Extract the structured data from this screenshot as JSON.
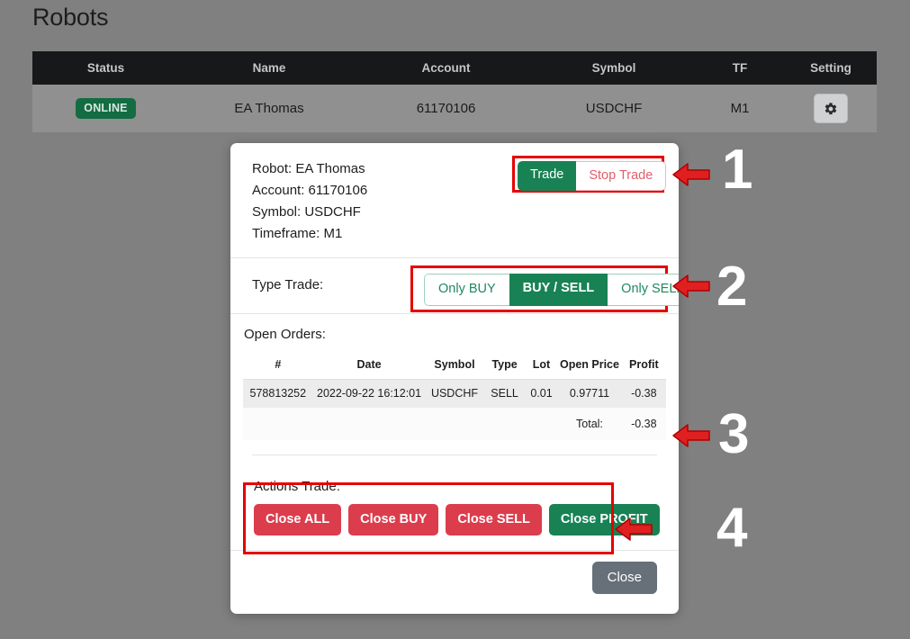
{
  "page": {
    "title": "Robots",
    "background_color": "#808080"
  },
  "robots_table": {
    "columns": [
      "Status",
      "Name",
      "Account",
      "Symbol",
      "TF",
      "Setting"
    ],
    "rows": [
      {
        "status": "ONLINE",
        "name": "EA Thomas",
        "account": "61170106",
        "symbol": "USDCHF",
        "tf": "M1",
        "setting_icon": "gear-icon"
      }
    ],
    "status_color": "#146c43",
    "header_background": "#16181a"
  },
  "modal": {
    "info": {
      "robot": "Robot: EA Thomas",
      "account": "Account: 61170106",
      "symbol": "Symbol: USDCHF",
      "timeframe": "Timeframe: M1"
    },
    "trade_toggle": {
      "active_label": "Trade",
      "inactive_label": "Stop Trade",
      "active_color": "#188254",
      "inactive_text_color": "#e35d6a"
    },
    "type_trade": {
      "label": "Type Trade:",
      "options": [
        "Only BUY",
        "BUY / SELL",
        "Only SELL"
      ],
      "selected": "BUY / SELL",
      "selected_color": "#188254"
    },
    "open_orders": {
      "label": "Open Orders:",
      "columns": [
        "#",
        "Date",
        "Symbol",
        "Type",
        "Lot",
        "Open Price",
        "Profit"
      ],
      "rows": [
        {
          "id": "578813252",
          "date": "2022-09-22 16:12:01",
          "symbol": "USDCHF",
          "type": "SELL",
          "lot": "0.01",
          "open_price": "0.97711",
          "profit": "-0.38"
        }
      ],
      "total_label": "Total:",
      "total_value": "-0.38"
    },
    "actions": {
      "label": "Actions Trade:",
      "buttons": [
        {
          "label": "Close ALL",
          "color": "#dc3d4d"
        },
        {
          "label": "Close BUY",
          "color": "#dc3d4d"
        },
        {
          "label": "Close SELL",
          "color": "#dc3d4d"
        },
        {
          "label": "Close PROFIT",
          "color": "#188254"
        }
      ]
    },
    "footer": {
      "close_label": "Close",
      "close_color": "#676f79"
    }
  },
  "annotations": {
    "highlight_color": "#e60000",
    "arrow_color": "#e02020",
    "numbers": [
      "1",
      "2",
      "3",
      "4"
    ]
  }
}
